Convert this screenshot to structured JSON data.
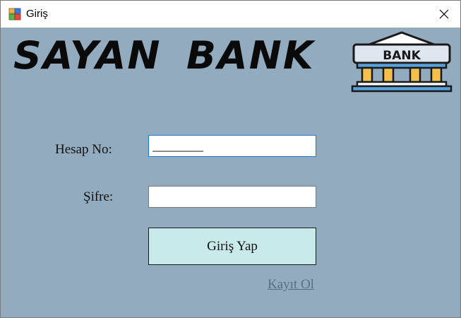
{
  "window": {
    "title": "Giriş",
    "close_glyph": "✕",
    "icons": {
      "app": "windows-form-icon",
      "close": "close-icon"
    }
  },
  "brand": {
    "name": "SAYAN  BANK",
    "logo_text": "BANK",
    "logo_icon": "bank-building-icon"
  },
  "form": {
    "account_label": "Hesap No:",
    "account_value": "________",
    "password_label": "Şifre:",
    "password_value": "",
    "login_button": "Giriş Yap",
    "register_link": "Kayıt Ol"
  },
  "colors": {
    "background": "#93abbf",
    "button": "#c9eaeb",
    "link": "#5a6f80",
    "focus_border": "#1f7bd1"
  }
}
